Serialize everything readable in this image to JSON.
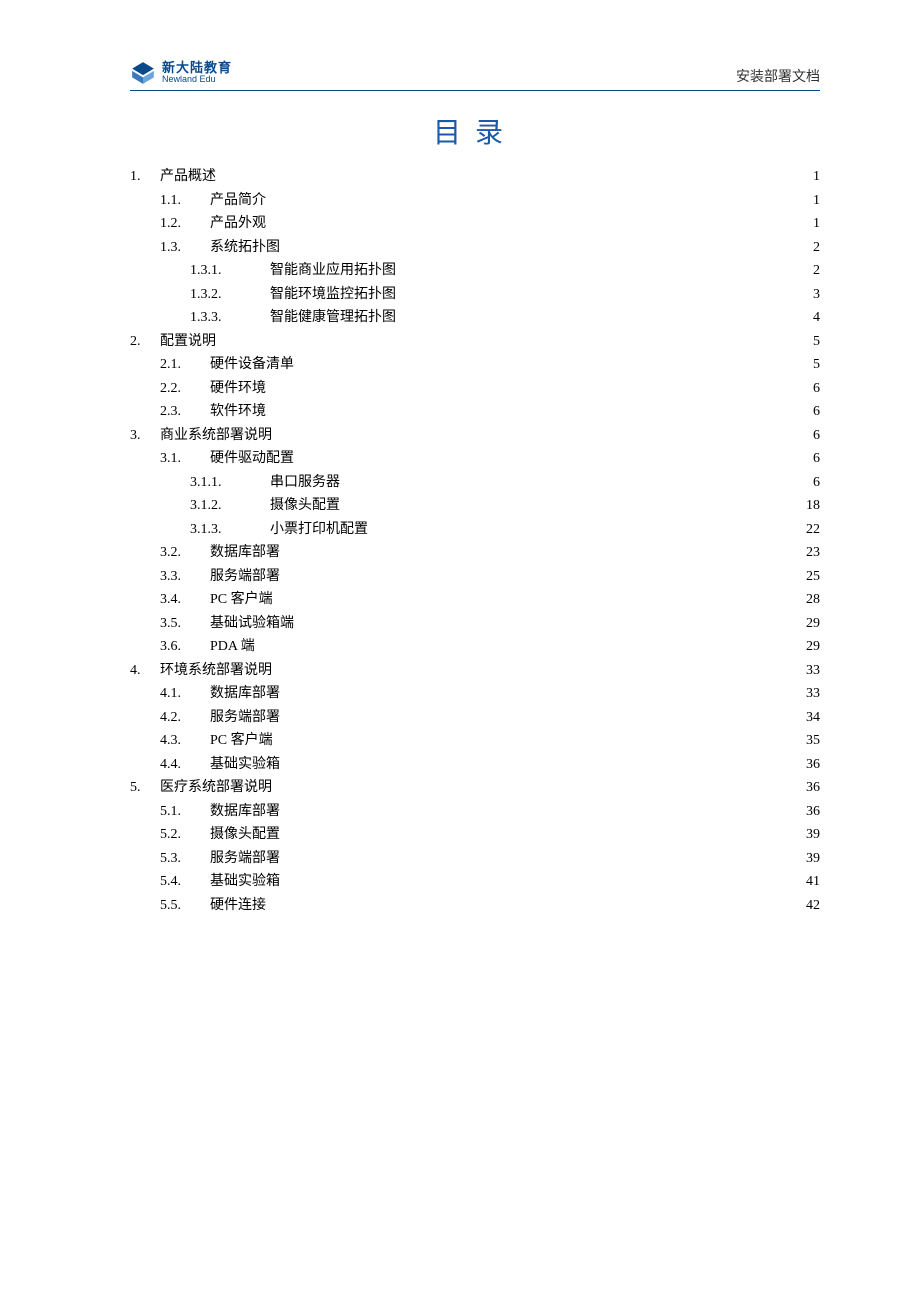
{
  "header": {
    "logo_cn": "新大陆教育",
    "logo_en": "Newland Edu",
    "doc_label": "安装部署文档"
  },
  "title": "目录",
  "toc": [
    {
      "level": 1,
      "num": "1.",
      "text": "产品概述",
      "page": "1"
    },
    {
      "level": 2,
      "num": "1.1.",
      "text": "产品简介",
      "page": "1"
    },
    {
      "level": 2,
      "num": "1.2.",
      "text": "产品外观",
      "page": "1"
    },
    {
      "level": 2,
      "num": "1.3.",
      "text": "系统拓扑图",
      "page": "2"
    },
    {
      "level": 3,
      "num": "1.3.1.",
      "text": "智能商业应用拓扑图",
      "page": "2"
    },
    {
      "level": 3,
      "num": "1.3.2.",
      "text": "智能环境监控拓扑图",
      "page": "3"
    },
    {
      "level": 3,
      "num": "1.3.3.",
      "text": "智能健康管理拓扑图",
      "page": "4"
    },
    {
      "level": 1,
      "num": "2.",
      "text": "配置说明",
      "page": "5"
    },
    {
      "level": 2,
      "num": "2.1.",
      "text": "硬件设备清单",
      "page": "5"
    },
    {
      "level": 2,
      "num": "2.2.",
      "text": "硬件环境",
      "page": "6"
    },
    {
      "level": 2,
      "num": "2.3.",
      "text": "软件环境",
      "page": "6"
    },
    {
      "level": 1,
      "num": "3.",
      "text": "商业系统部署说明",
      "page": "6"
    },
    {
      "level": 2,
      "num": "3.1.",
      "text": "硬件驱动配置",
      "page": "6"
    },
    {
      "level": 3,
      "num": "3.1.1.",
      "text": "串口服务器",
      "page": "6"
    },
    {
      "level": 3,
      "num": "3.1.2.",
      "text": "摄像头配置",
      "page": "18"
    },
    {
      "level": 3,
      "num": "3.1.3.",
      "text": "小票打印机配置",
      "page": "22"
    },
    {
      "level": 2,
      "num": "3.2.",
      "text": "数据库部署",
      "page": "23"
    },
    {
      "level": 2,
      "num": "3.3.",
      "text": "服务端部署",
      "page": "25"
    },
    {
      "level": 2,
      "num": "3.4.",
      "text": "PC 客户端",
      "page": "28"
    },
    {
      "level": 2,
      "num": "3.5.",
      "text": "基础试验箱端",
      "page": "29"
    },
    {
      "level": 2,
      "num": "3.6.",
      "text": "PDA 端",
      "page": "29"
    },
    {
      "level": 1,
      "num": "4.",
      "text": "环境系统部署说明",
      "page": "33"
    },
    {
      "level": 2,
      "num": "4.1.",
      "text": "数据库部署",
      "page": "33"
    },
    {
      "level": 2,
      "num": "4.2.",
      "text": "服务端部署",
      "page": "34"
    },
    {
      "level": 2,
      "num": "4.3.",
      "text": "PC 客户端",
      "page": "35"
    },
    {
      "level": 2,
      "num": "4.4.",
      "text": "基础实验箱",
      "page": "36"
    },
    {
      "level": 1,
      "num": "5.",
      "text": "医疗系统部署说明",
      "page": "36"
    },
    {
      "level": 2,
      "num": "5.1.",
      "text": "数据库部署",
      "page": "36"
    },
    {
      "level": 2,
      "num": "5.2.",
      "text": "摄像头配置",
      "page": "39"
    },
    {
      "level": 2,
      "num": "5.3.",
      "text": "服务端部署",
      "page": "39"
    },
    {
      "level": 2,
      "num": "5.4.",
      "text": "基础实验箱",
      "page": "41"
    },
    {
      "level": 2,
      "num": "5.5.",
      "text": "硬件连接",
      "page": "42"
    }
  ]
}
